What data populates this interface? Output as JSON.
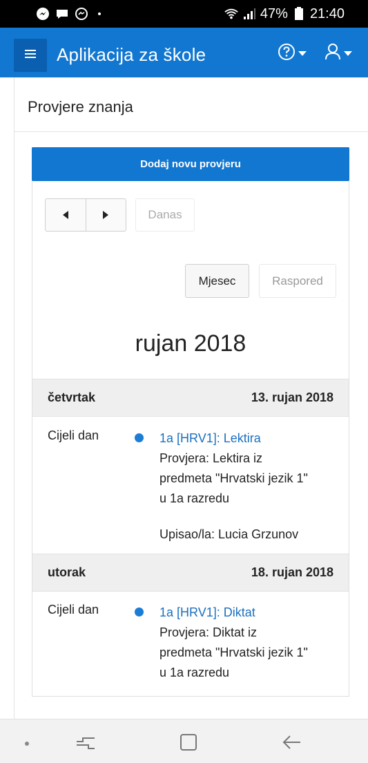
{
  "status_bar": {
    "battery": "47%",
    "time": "21:40"
  },
  "app_bar": {
    "title": "Aplikacija za škole",
    "menu_icon": "hamburger-menu-icon",
    "help_icon": "question-circle-icon",
    "user_icon": "user-icon"
  },
  "page": {
    "title": "Provjere znanja"
  },
  "calendar": {
    "add_button": "Dodaj novu provjeru",
    "today_button": "Danas",
    "view_month": "Mjesec",
    "view_schedule": "Raspored",
    "month_title": "rujan 2018",
    "days": [
      {
        "weekday": "četvrtak",
        "date": "13. rujan 2018",
        "events": [
          {
            "time": "Cijeli dan",
            "title": "1a [HRV1]: Lektira",
            "desc_lines": [
              "Provjera: Lektira iz",
              "predmeta \"Hrvatski jezik 1\"",
              "u 1a razredu"
            ],
            "author": "Upisao/la: Lucia Grzunov"
          }
        ]
      },
      {
        "weekday": "utorak",
        "date": "18. rujan 2018",
        "events": [
          {
            "time": "Cijeli dan",
            "title": "1a [HRV1]: Diktat",
            "desc_lines": [
              "Provjera: Diktat iz",
              "predmeta \"Hrvatski jezik 1\"",
              "u 1a razredu"
            ]
          }
        ]
      }
    ]
  },
  "colors": {
    "primary": "#1177d1",
    "event_link": "#1a6fbf",
    "event_dot": "#1b7dd6"
  }
}
